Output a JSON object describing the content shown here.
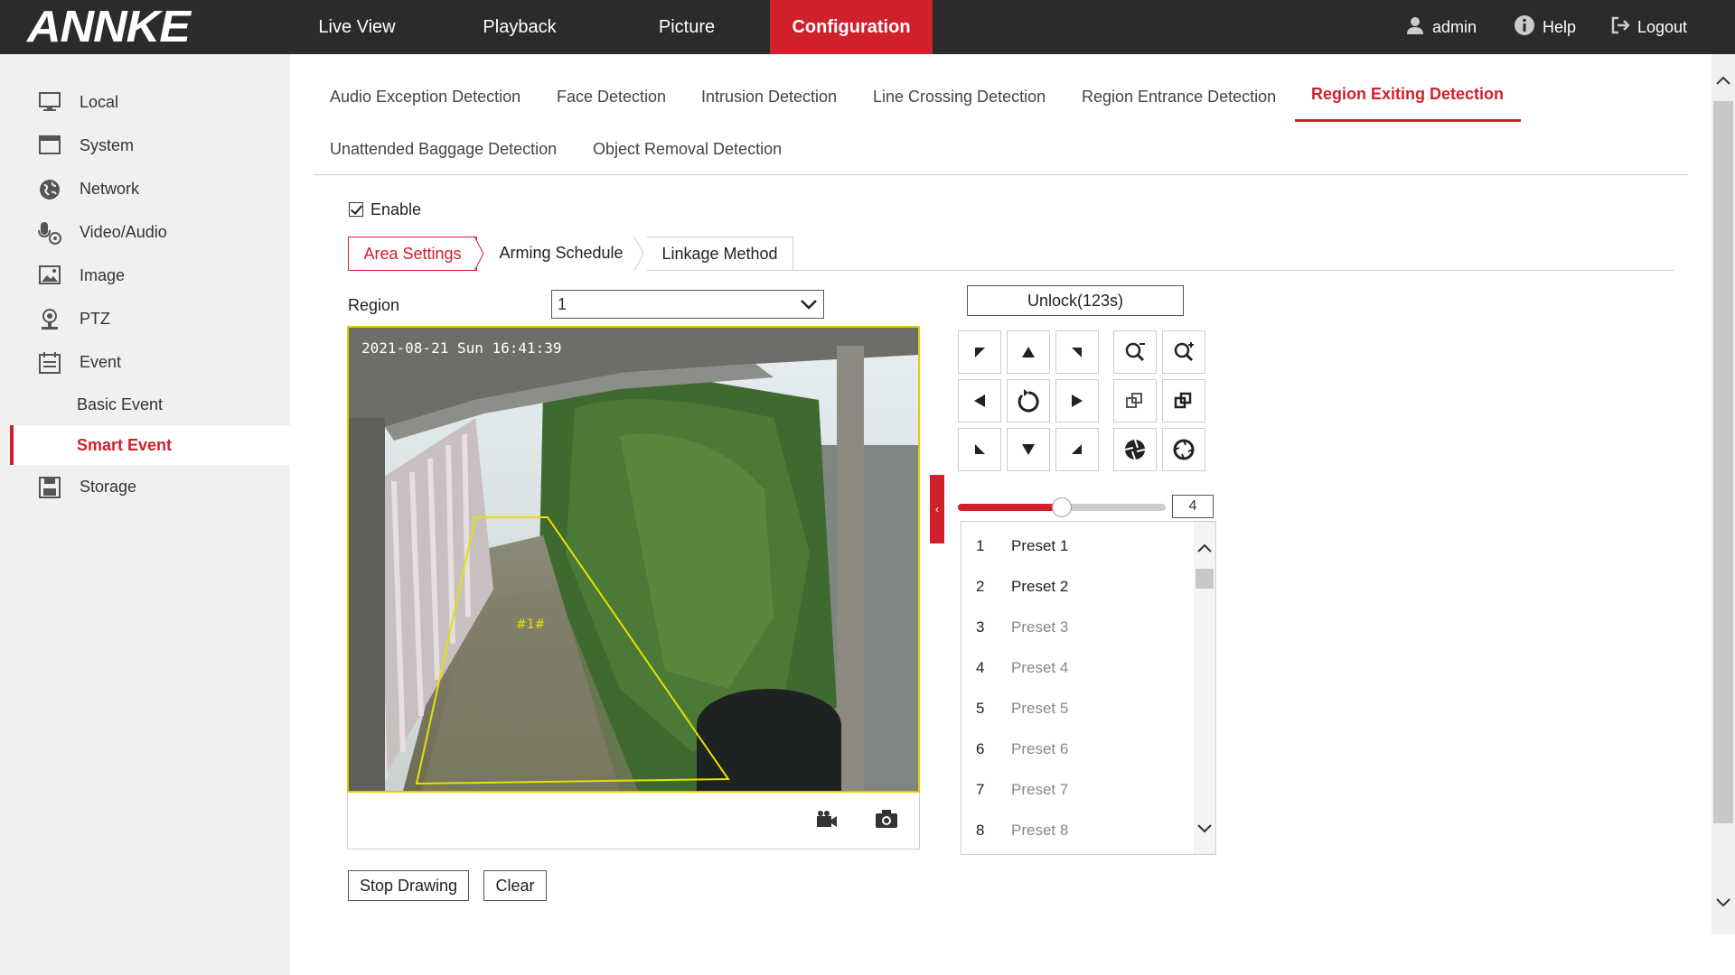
{
  "brand": "ANNKE",
  "nav": {
    "items": [
      {
        "label": "Live View",
        "active": false
      },
      {
        "label": "Playback",
        "active": false
      },
      {
        "label": "Picture",
        "active": false
      },
      {
        "label": "Configuration",
        "active": true
      }
    ],
    "user": "admin",
    "help": "Help",
    "logout": "Logout"
  },
  "sidebar": {
    "items": [
      {
        "label": "Local",
        "icon": "monitor-icon"
      },
      {
        "label": "System",
        "icon": "system-icon"
      },
      {
        "label": "Network",
        "icon": "globe-icon"
      },
      {
        "label": "Video/Audio",
        "icon": "video-audio-icon"
      },
      {
        "label": "Image",
        "icon": "image-icon"
      },
      {
        "label": "PTZ",
        "icon": "ptz-icon"
      },
      {
        "label": "Event",
        "icon": "calendar-icon"
      },
      {
        "label": "Storage",
        "icon": "floppy-disk-icon"
      }
    ],
    "event_sub": [
      {
        "label": "Basic Event",
        "active": false
      },
      {
        "label": "Smart Event",
        "active": true
      }
    ]
  },
  "tabs": {
    "row1": [
      "Audio Exception Detection",
      "Face Detection",
      "Intrusion Detection",
      "Line Crossing Detection",
      "Region Entrance Detection",
      "Region Exiting Detection"
    ],
    "row2": [
      "Unattended Baggage Detection",
      "Object Removal Detection"
    ],
    "active": "Region Exiting Detection"
  },
  "enable": {
    "label": "Enable",
    "checked": true
  },
  "subtabs": [
    "Area Settings",
    "Arming Schedule",
    "Linkage Method"
  ],
  "region": {
    "label": "Region",
    "value": "1"
  },
  "video": {
    "osd_time": "2021-08-21 Sun 16:41:39",
    "region_tag": "#1#"
  },
  "buttons": {
    "stop_drawing": "Stop Drawing",
    "clear": "Clear",
    "unlock": "Unlock(123s)"
  },
  "ptz": {
    "speed": 4,
    "speed_max": 7,
    "presets": [
      {
        "num": "1",
        "label": "Preset 1",
        "defined": true
      },
      {
        "num": "2",
        "label": "Preset 2",
        "defined": true
      },
      {
        "num": "3",
        "label": "Preset 3",
        "defined": false
      },
      {
        "num": "4",
        "label": "Preset 4",
        "defined": false
      },
      {
        "num": "5",
        "label": "Preset 5",
        "defined": false
      },
      {
        "num": "6",
        "label": "Preset 6",
        "defined": false
      },
      {
        "num": "7",
        "label": "Preset 7",
        "defined": false
      },
      {
        "num": "8",
        "label": "Preset 8",
        "defined": false
      }
    ]
  },
  "colors": {
    "accent": "#d0202c",
    "topbar": "#2b2b2b",
    "region_line": "#e7e000"
  }
}
